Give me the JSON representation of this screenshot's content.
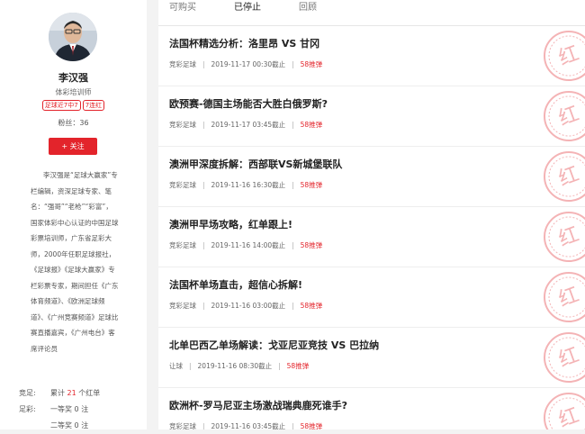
{
  "profile": {
    "name": "李汉强",
    "title": "体彩培训师",
    "badges": [
      "足球近7中7",
      "7连红"
    ],
    "fans_label": "粉丝：",
    "fans_count": "36",
    "follow_label": "+ 关注",
    "bio": "李汉强是“足球大赢家”专栏编辑，资深足球专家、笔名：“强哥”“老枪”“彩富”，国家体彩中心认证的中国足球彩票培训师，广东省足彩大师，2000年任职足球报社，《足球报》《足球大赢家》专栏彩票专家，期间担任《广东体育频道》、《欧洲足球频道》、《广州竞赛频道》足球比赛直播嘉宾，《广州电台》客席评论员"
  },
  "stats": [
    {
      "label": "竞足:",
      "prefix": "累计",
      "num": "21",
      "suffix": "个红单"
    },
    {
      "label": "足彩:",
      "prefix": "一等奖",
      "num": "0",
      "suffix": "注"
    },
    {
      "label": "",
      "prefix": "二等奖",
      "num": "0",
      "suffix": "注"
    }
  ],
  "tabs": [
    {
      "label": "可购买"
    },
    {
      "label": "已停止"
    },
    {
      "label": "回顾"
    }
  ],
  "articles": [
    {
      "title": "法国杯精选分析：洛里昂 VS 甘冈",
      "category": "竞彩足球",
      "time": "2019-11-17 00:30截止",
      "hot": "58推弹"
    },
    {
      "title": "欧预赛-德国主场能否大胜白俄罗斯?",
      "category": "竞彩足球",
      "time": "2019-11-17 03:45截止",
      "hot": "58推弹"
    },
    {
      "title": "澳洲甲深度拆解：西部联VS新城堡联队",
      "category": "竞彩足球",
      "time": "2019-11-16 16:30截止",
      "hot": "58推弹"
    },
    {
      "title": "澳洲甲早场攻略，红单跟上!",
      "category": "竞彩足球",
      "time": "2019-11-16 14:00截止",
      "hot": "58推弹"
    },
    {
      "title": "法国杯单场直击，超信心拆解!",
      "category": "竞彩足球",
      "time": "2019-11-16 03:00截止",
      "hot": "58推弹"
    },
    {
      "title": "北单巴西乙单场解读：戈亚尼亚竞技 VS 巴拉纳",
      "category": "让球",
      "time": "2019-11-16 08:30截止",
      "hot": "58推弹"
    },
    {
      "title": "欧洲杯-罗马尼亚主场激战瑞典鹿死谁手?",
      "category": "竞彩足球",
      "time": "2019-11-16 03:45截止",
      "hot": "58推弹"
    }
  ],
  "stamp_text": "红",
  "colors": {
    "accent": "#e3242b",
    "background": "#f3f3f3"
  }
}
